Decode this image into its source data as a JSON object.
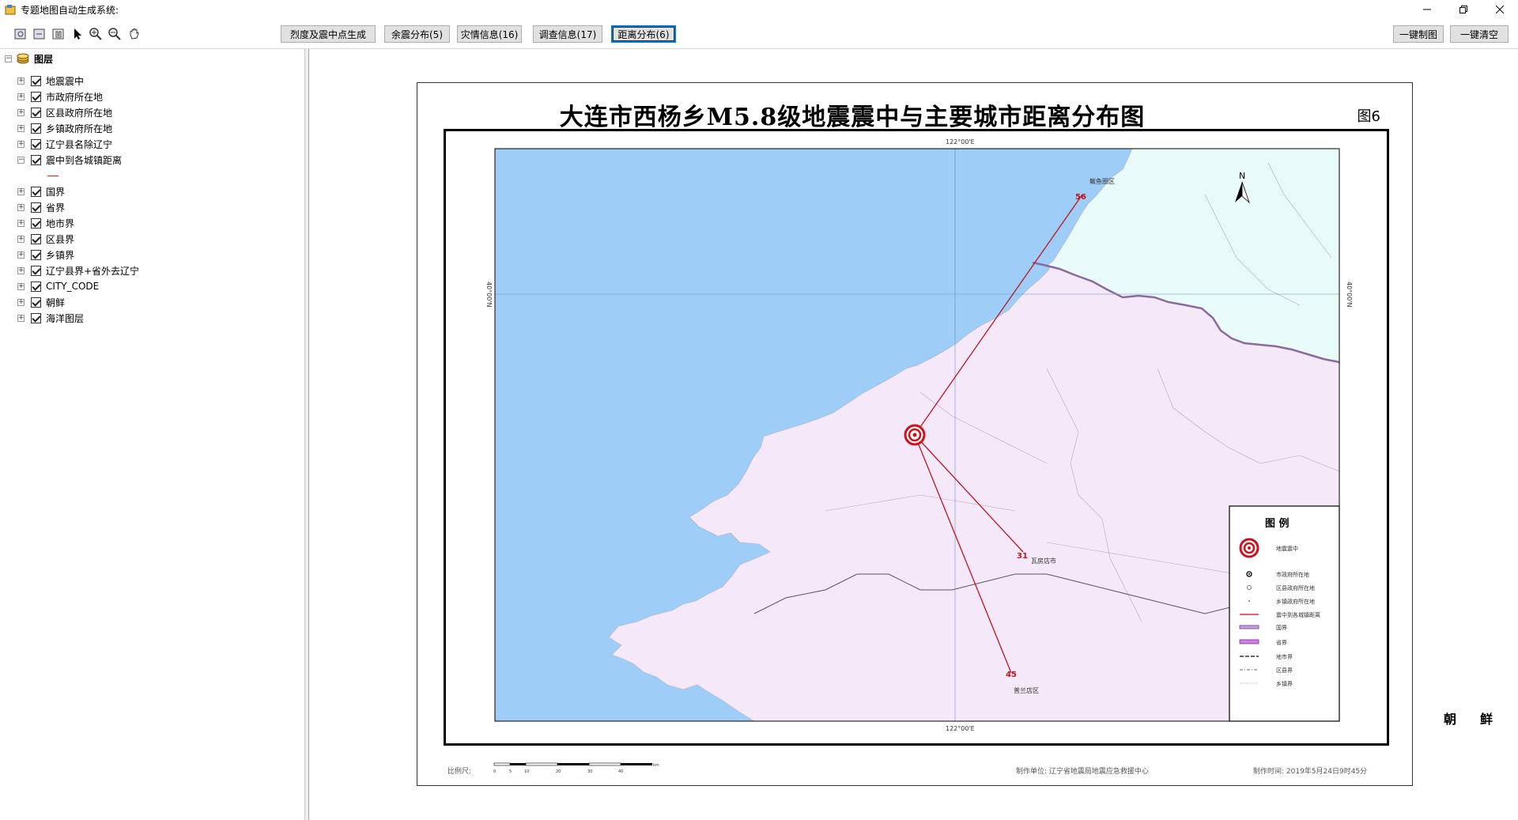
{
  "window": {
    "title": "专题地图自动生成系统:",
    "icon": "app-icon",
    "controls": [
      "minimize-icon",
      "restore-icon",
      "close-icon"
    ]
  },
  "toolbar": {
    "tools": [
      "full-extent-icon",
      "fixed-zoom-icon",
      "pan-map-icon",
      "select-pointer-icon",
      "zoom-in-icon",
      "zoom-out-icon",
      "hand-pan-icon"
    ],
    "buttons": {
      "intensity": "烈度及震中点生成",
      "aftershock": "余震分布(5)",
      "disaster": "灾情信息(16)",
      "survey": "调查信息(17)",
      "distance": "距离分布(6)",
      "make_map": "一键制图",
      "clear": "一键清空"
    }
  },
  "tree": {
    "root": "图层",
    "layers": [
      {
        "label": "地震震中",
        "expanded": false
      },
      {
        "label": "市政府所在地",
        "expanded": false
      },
      {
        "label": "区县政府所在地",
        "expanded": false
      },
      {
        "label": "乡镇政府所在地",
        "expanded": false
      },
      {
        "label": "辽宁县名除辽宁",
        "expanded": false
      },
      {
        "label": "震中到各城镇距离",
        "expanded": true
      },
      {
        "label": "国界",
        "expanded": false
      },
      {
        "label": "省界",
        "expanded": false
      },
      {
        "label": "地市界",
        "expanded": false
      },
      {
        "label": "区县界",
        "expanded": false
      },
      {
        "label": "乡镇界",
        "expanded": false
      },
      {
        "label": "辽宁县界+省外去辽宁",
        "expanded": false
      },
      {
        "label": "CITY_CODE",
        "expanded": false
      },
      {
        "label": "朝鲜",
        "expanded": false
      },
      {
        "label": "海洋图层",
        "expanded": false
      }
    ],
    "legend_line_color": "#e02020"
  },
  "map": {
    "title": "大连市西杨乡M5.8级地震震中与主要城市距离分布图",
    "figure_no": "图6",
    "coord_top": "122°00'E",
    "coord_bottom": "122°00'E",
    "coord_left": "40°00'N",
    "coord_right": "40°00'N",
    "north": "N",
    "places": {
      "bayuquan": "鲅鱼圈区",
      "wafangdian": "瓦房店市",
      "pulandian": "普兰店区"
    },
    "distances": {
      "to_bayuquan": "56",
      "to_wafangdian": "31",
      "to_pulandian": "45"
    },
    "legend": {
      "title": "图  例",
      "items": [
        "地震震中",
        "市政府所在地",
        "区县政府所在地",
        "乡镇政府所在地",
        "震中到各城镇距离",
        "国界",
        "省界",
        "地市界",
        "区县界",
        "乡镇界"
      ]
    },
    "scale_label": "比例尺:",
    "scale_ticks": [
      "0",
      "5",
      "10",
      "20",
      "30",
      "40",
      "km"
    ],
    "producer": "制作单位: 辽宁省地震局地震应急救援中心",
    "time": "制作时间: 2019年5月24日9时45分",
    "colors": {
      "sea": "#9ecdf7",
      "land": "#f5e9f9",
      "other_land": "#e8fbf8",
      "line": "#c0141e",
      "province": "#8a6b9c"
    }
  },
  "outside_label": "朝鲜"
}
